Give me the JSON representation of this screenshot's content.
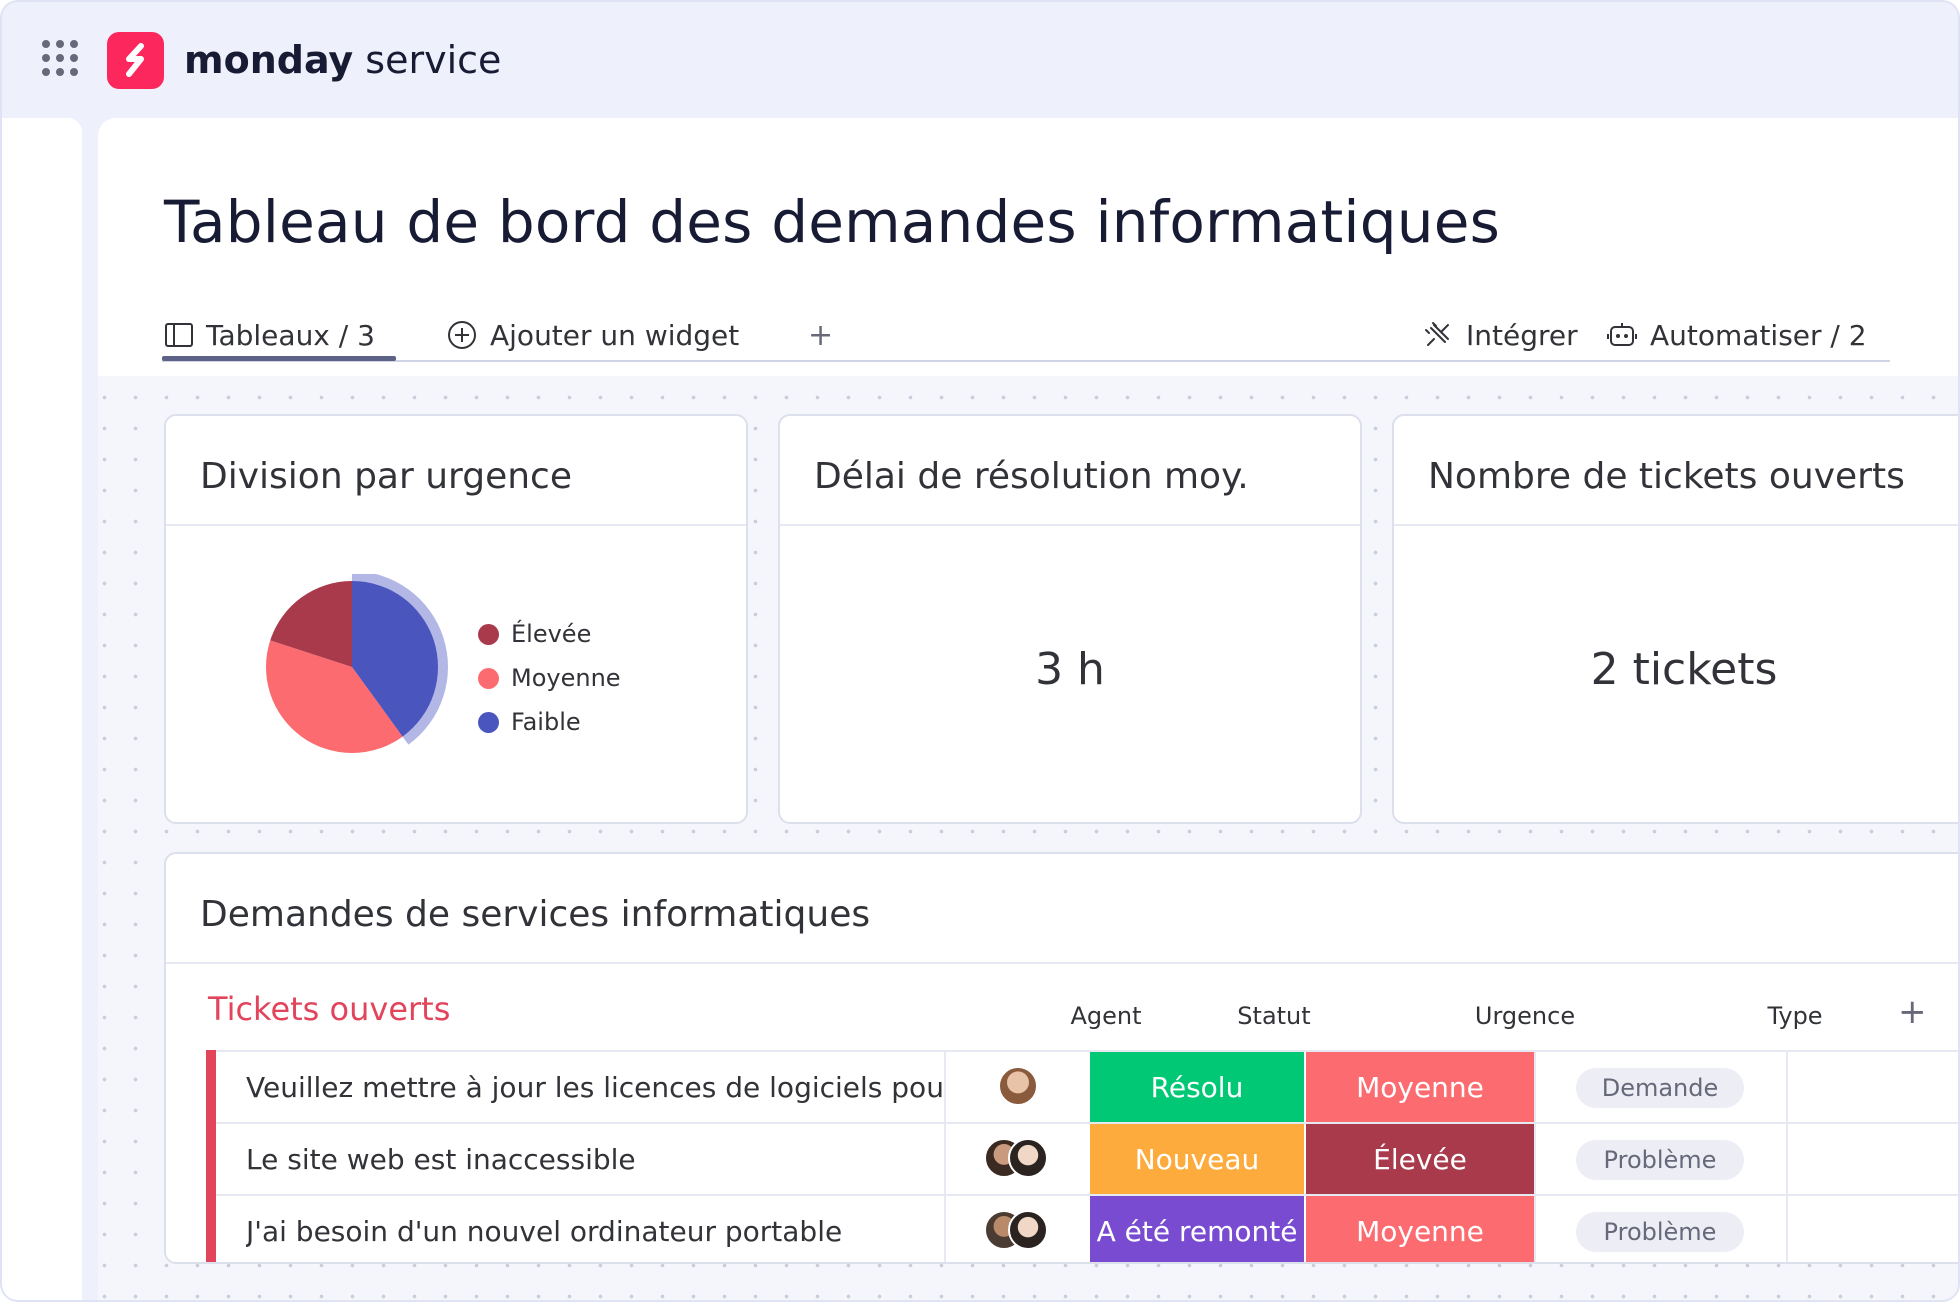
{
  "app": {
    "brand_bold": "monday",
    "brand_light": "service",
    "brand_color": "#fb275d"
  },
  "page": {
    "title": "Tableau de bord des demandes informatiques"
  },
  "tabs": {
    "boards_label": "Tableaux / 3",
    "add_widget_label": "Ajouter un widget",
    "add_label": "+",
    "integrate_label": "Intégrer",
    "automate_label": "Automatiser / 2"
  },
  "widgets": {
    "urgency": {
      "title": "Division par urgence",
      "legend": [
        {
          "label": "Élevée",
          "color": "#a83a4c"
        },
        {
          "label": "Moyenne",
          "color": "#fb6b70"
        },
        {
          "label": "Faible",
          "color": "#4a55bd"
        }
      ]
    },
    "resolution": {
      "title": "Délai de résolution moy.",
      "value": "3 h"
    },
    "open_tickets": {
      "title": "Nombre de tickets ouverts",
      "value": "2 tickets"
    }
  },
  "chart_data": {
    "type": "pie",
    "title": "Division par urgence",
    "slices": [
      {
        "label": "Faible",
        "value": 40,
        "color": "#4a55bd"
      },
      {
        "label": "Moyenne",
        "value": 40,
        "color": "#fb6b70"
      },
      {
        "label": "Élevée",
        "value": 20,
        "color": "#a83a4c"
      }
    ],
    "legend_position": "right"
  },
  "board": {
    "title": "Demandes de services informatiques",
    "group_title": "Tickets ouverts",
    "columns": {
      "agent": "Agent",
      "status": "Statut",
      "urgency": "Urgence",
      "type": "Type",
      "add": "+"
    },
    "rows": [
      {
        "name": "Veuillez mettre à jour les licences de logiciels pour ...",
        "status": "Résolu",
        "status_color": "#00c875",
        "urgency": "Moyenne",
        "urgency_color": "#fb6b70",
        "type": "Demande"
      },
      {
        "name": "Le site web est inaccessible",
        "status": "Nouveau",
        "status_color": "#fdab3d",
        "urgency": "Élevée",
        "urgency_color": "#a83a4c",
        "type": "Problème"
      },
      {
        "name": "J'ai besoin d'un nouvel ordinateur portable",
        "status": "A été remonté",
        "status_color": "#784bd1",
        "urgency": "Moyenne",
        "urgency_color": "#fb6b70",
        "type": "Problème"
      }
    ]
  }
}
